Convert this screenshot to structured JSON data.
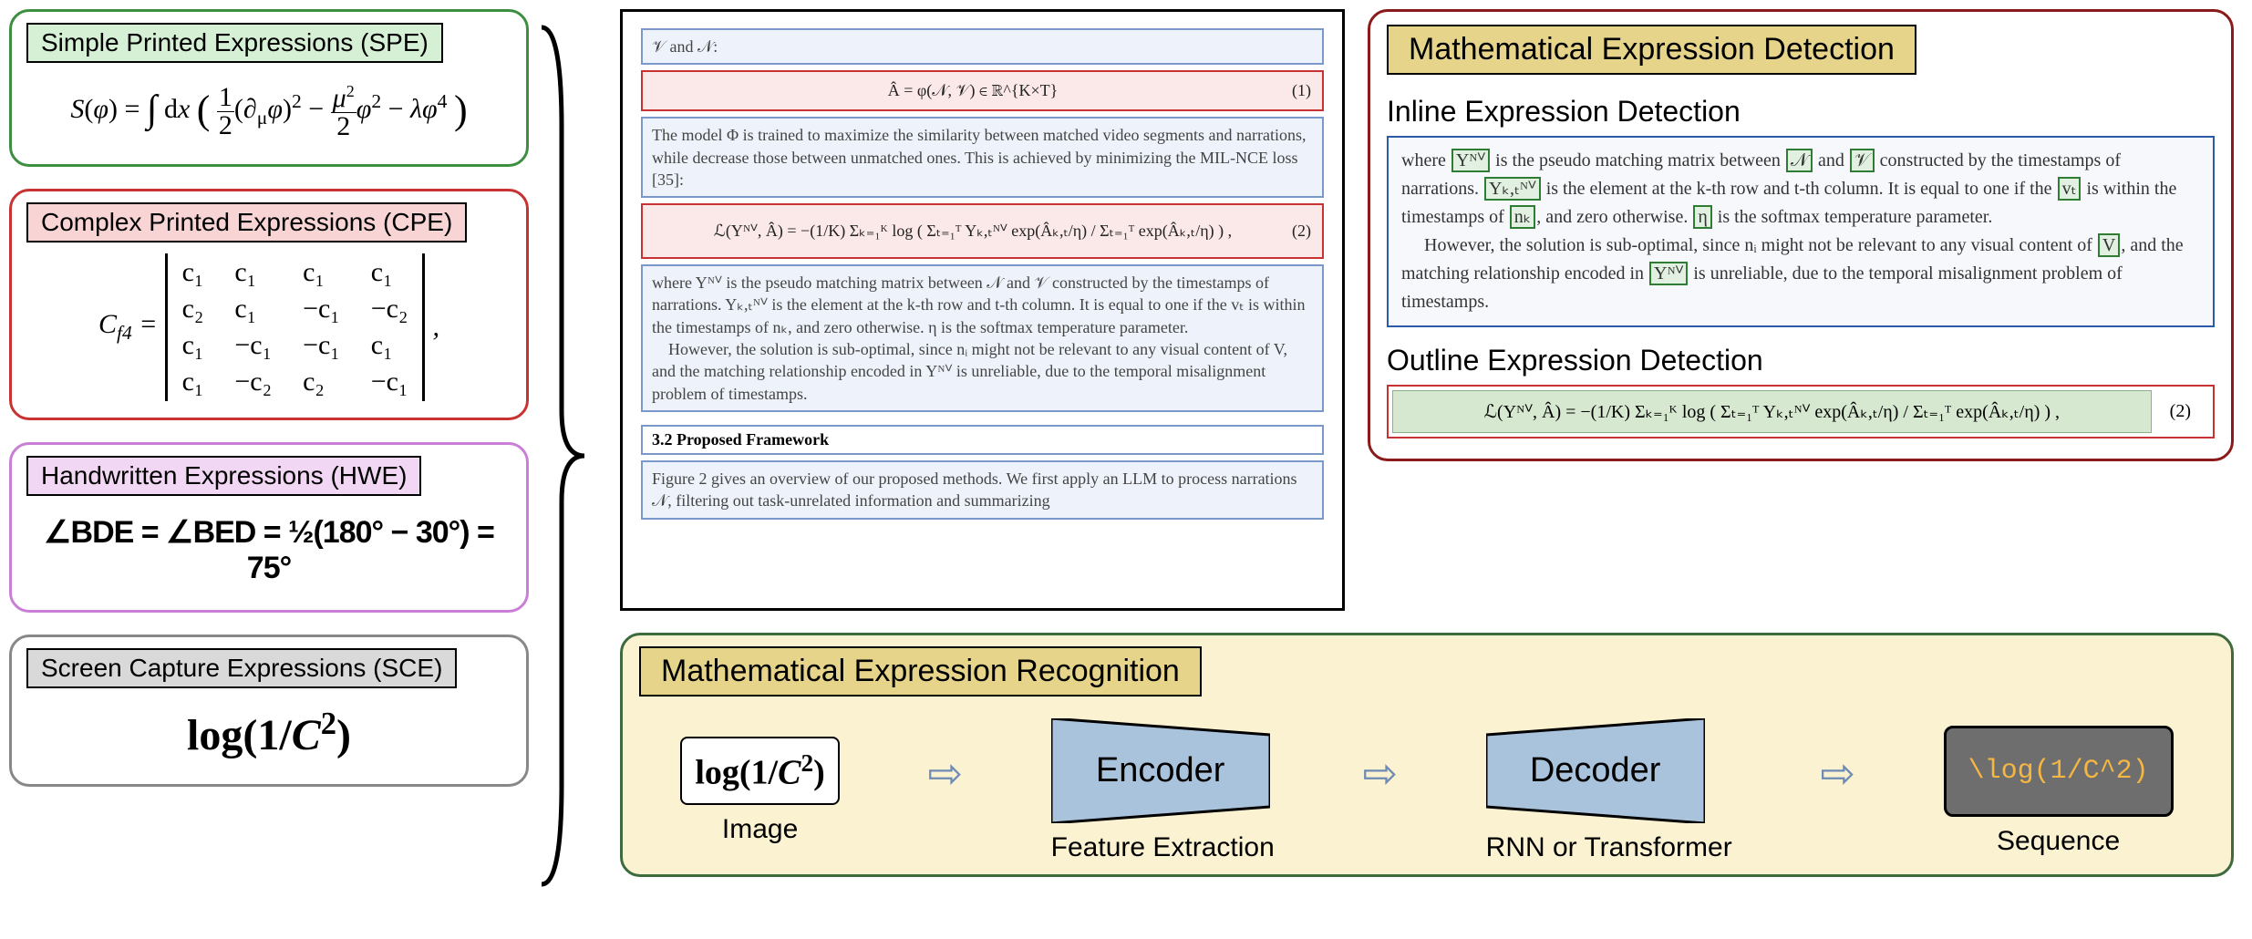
{
  "left": {
    "spe": {
      "label": "Simple Printed Expressions (SPE)",
      "expr_tex": "S(φ) = ∫ dx ( ½(∂μφ)² − (μ²/2)φ² − λφ⁴ )"
    },
    "cpe": {
      "label": "Complex Printed Expressions (CPE)",
      "lhs": "C_{f4} =",
      "matrix": [
        [
          "c₁",
          "c₁",
          "c₁",
          "c₁"
        ],
        [
          "c₂",
          "c₁",
          "−c₁",
          "−c₂"
        ],
        [
          "c₁",
          "−c₁",
          "−c₁",
          "c₁"
        ],
        [
          "c₁",
          "−c₂",
          "c₂",
          "−c₁"
        ]
      ],
      "trail": ","
    },
    "hwe": {
      "label": "Handwritten Expressions (HWE)",
      "expr": "∠BDE = ∠BED = ½(180° − 30°) = 75°"
    },
    "sce": {
      "label": "Screen Capture Expressions (SCE)",
      "expr": "log(1/C²)"
    }
  },
  "center": {
    "line_vn": "𝒱 and 𝒩:",
    "eq1": "Â = φ(𝒩, 𝒱) ∈ ℝ^{K×T}",
    "eq1_num": "(1)",
    "para1": "The model Φ is trained to maximize the similarity between matched video segments and narrations, while decrease those between unmatched ones. This is achieved by minimizing the MIL-NCE loss [35]:",
    "eq2": "ℒ(Yᴺⱽ, Â) = −(1/K) Σₖ₌₁ᴷ log ( Σₜ₌₁ᵀ Yₖ,ₜᴺⱽ exp(Âₖ,ₜ/η) / Σₜ₌₁ᵀ exp(Âₖ,ₜ/η) ) ,",
    "eq2_num": "(2)",
    "para2": "where Yᴺⱽ is the pseudo matching matrix between 𝒩 and 𝒱 constructed by the timestamps of narrations. Yₖ,ₜᴺⱽ is the element at the k-th row and t-th column. It is equal to one if the vₜ is within the timestamps of nₖ, and zero otherwise. η is the softmax temperature parameter.",
    "para2b": "However, the solution is sub-optimal, since nᵢ might not be relevant to any visual content of V, and the matching relationship encoded in Yᴺⱽ is unreliable, due to the temporal misalignment problem of timestamps.",
    "sect": "3.2    Proposed Framework",
    "para3": "Figure 2 gives an overview of our proposed methods. We first apply an LLM to process narrations 𝒩, filtering out task-unrelated information and summarizing"
  },
  "detection": {
    "title": "Mathematical Expression Detection",
    "inline_title": "Inline Expression Detection",
    "inline": {
      "t1a": "where ",
      "hl1": "Yᴺⱽ",
      "t1b": " is the pseudo matching matrix between ",
      "hl2": "𝒩",
      "t1c": " and ",
      "hl3": "𝒱",
      "t1d": " constructed by the timestamps of narrations. ",
      "hl4": "Yₖ,ₜᴺⱽ",
      "t1e": " is the element at the k-th row and t-th column. It is equal to one if the ",
      "hl5": "vₜ",
      "t1f": " is within the timestamps of ",
      "hl6": "nₖ",
      "t1g": ", and zero otherwise. ",
      "hl7": "η",
      "t1h": " is the softmax temperature parameter.",
      "t2a": "However, the solution is sub-optimal, since nᵢ might not be relevant to any visual content of ",
      "hl8": "V",
      "t2b": ", and the matching relationship encoded in ",
      "hl9": "Yᴺⱽ",
      "t2c": " is unreliable, due to the temporal misalignment problem of timestamps."
    },
    "outline_title": "Outline Expression Detection",
    "outline_eq": "ℒ(Yᴺⱽ, Â) = −(1/K) Σₖ₌₁ᴷ log ( Σₜ₌₁ᵀ Yₖ,ₜᴺⱽ exp(Âₖ,ₜ/η) / Σₜ₌₁ᵀ exp(Âₖ,ₜ/η) ) ,",
    "outline_num": "(2)"
  },
  "recognition": {
    "title": "Mathematical Expression Recognition",
    "image_expr": "log(1/C²)",
    "image_label": "Image",
    "encoder": "Encoder",
    "encoder_label": "Feature Extraction",
    "decoder": "Decoder",
    "decoder_label": "RNN or Transformer",
    "output": "\\log(1/C^2)",
    "output_label": "Sequence"
  }
}
